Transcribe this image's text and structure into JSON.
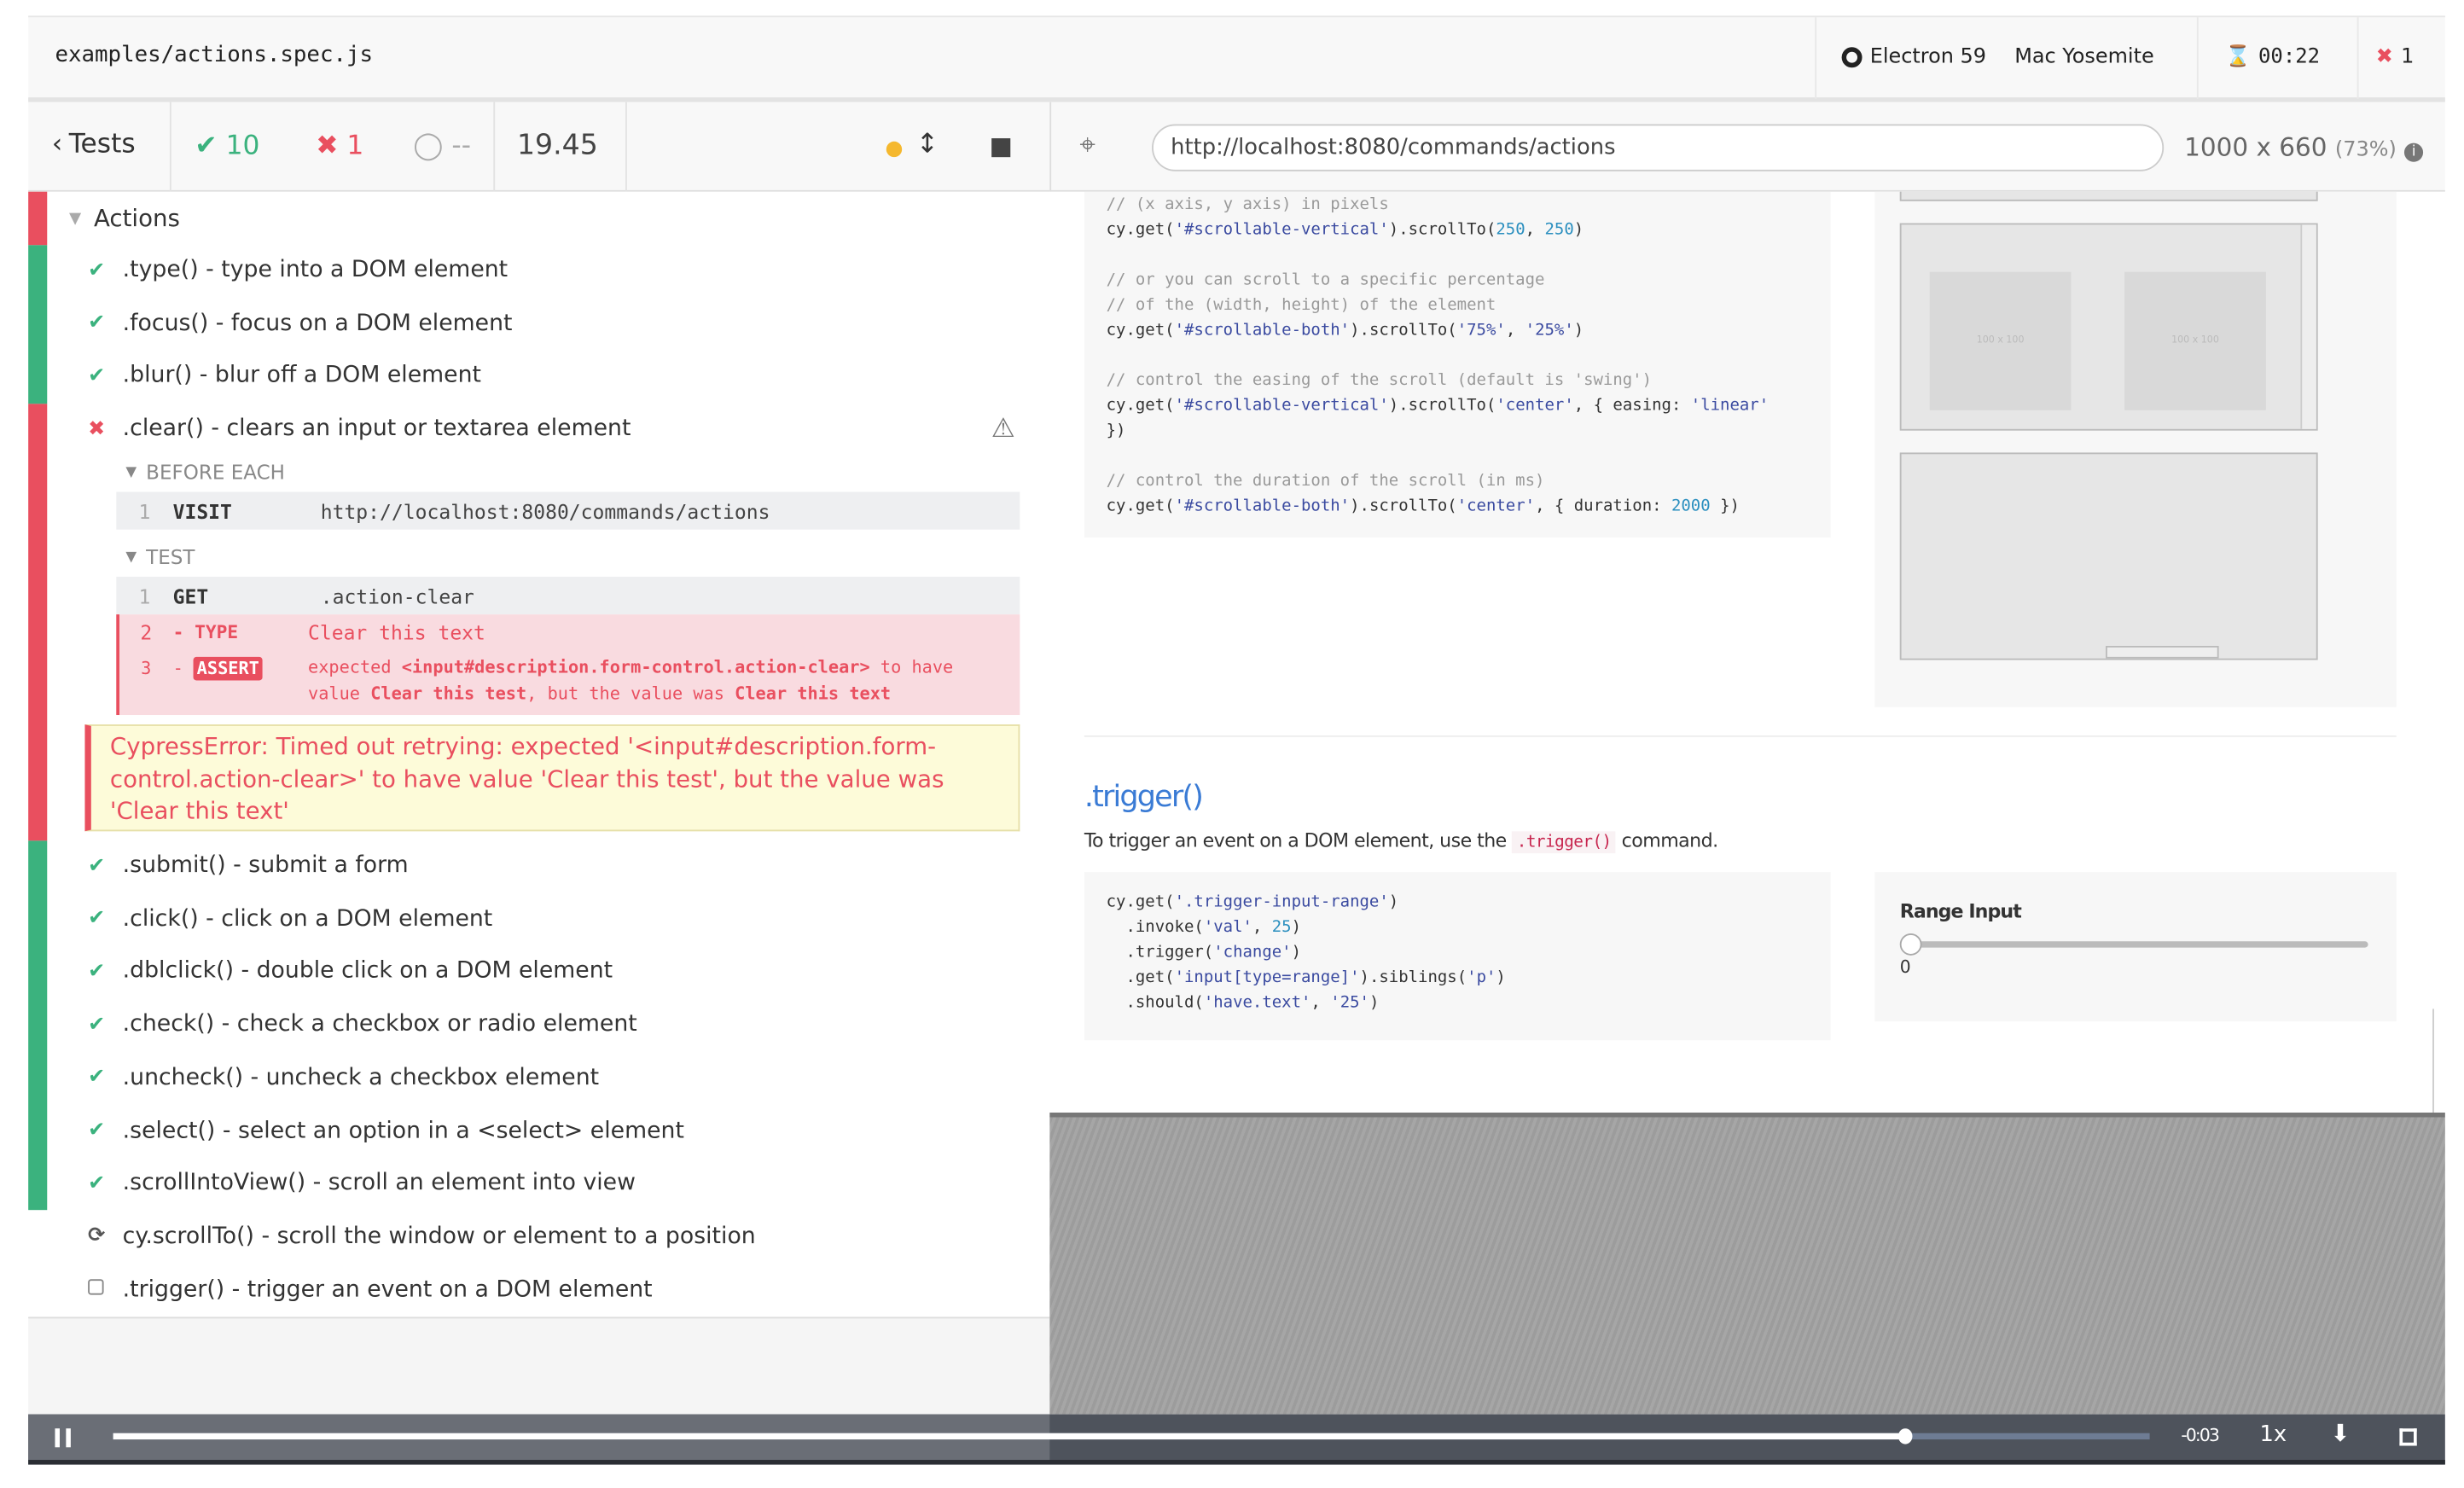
{
  "header": {
    "spec_file": "examples/actions.spec.js",
    "browser": "Electron 59",
    "os": "Mac Yosemite",
    "duration": "00:22",
    "failures": "1"
  },
  "reporter": {
    "tests_button": "Tests",
    "passed": "10",
    "failed": "1",
    "pending": "--",
    "elapsed": "19.45"
  },
  "aut": {
    "url": "http://localhost:8080/commands/actions",
    "viewport": "1000 x 660",
    "scale": "(73%)"
  },
  "suite": {
    "title": "Actions",
    "tests_before": [
      {
        "state": "passed",
        "title": ".type() - type into a DOM element"
      },
      {
        "state": "passed",
        "title": ".focus() - focus on a DOM element"
      },
      {
        "state": "passed",
        "title": ".blur() - blur off a DOM element"
      }
    ],
    "failed_test": {
      "title": ".clear() - clears an input or textarea element",
      "before_each_label": "BEFORE EACH",
      "before_each": [
        {
          "num": "1",
          "name": "VISIT",
          "msg": "http://localhost:8080/commands/actions"
        }
      ],
      "test_label": "TEST",
      "commands": [
        {
          "num": "1",
          "name": "GET",
          "msg": ".action-clear"
        },
        {
          "num": "2",
          "name": "- TYPE",
          "msg": "Clear this text"
        }
      ],
      "assert": {
        "num": "3",
        "dash": "-",
        "name": "ASSERT",
        "p1": "expected",
        "el": "<input#description.form-control.action-clear>",
        "p2": "to have",
        "p3": "value",
        "v1": "Clear this test",
        "p4": ", but the value was",
        "v2": "Clear this text"
      },
      "error": "CypressError: Timed out retrying: expected '<input#description.form-control.action-clear>' to have value 'Clear this test', but the value was 'Clear this text'"
    },
    "tests_after": [
      {
        "state": "passed",
        "title": ".submit() - submit a form"
      },
      {
        "state": "passed",
        "title": ".click() - click on a DOM element"
      },
      {
        "state": "passed",
        "title": ".dblclick() - double click on a DOM element"
      },
      {
        "state": "passed",
        "title": ".check() - check a checkbox or radio element"
      },
      {
        "state": "passed",
        "title": ".uncheck() - uncheck a checkbox element"
      },
      {
        "state": "passed",
        "title": ".select() - select an option in a <select> element"
      },
      {
        "state": "passed",
        "title": ".scrollIntoView() - scroll an element into view"
      },
      {
        "state": "running",
        "title": "cy.scrollTo() - scroll the window or element to a position"
      },
      {
        "state": "pending",
        "title": ".trigger() - trigger an event on a DOM element"
      }
    ]
  },
  "page": {
    "code1": [
      [
        "cm",
        "// (x axis, y axis) in pixels"
      ],
      [
        "mix",
        "cy.get(|'#scrollable-vertical'|).scrollTo(|250|, |250|)"
      ],
      [
        "",
        ""
      ],
      [
        "cm",
        "// or you can scroll to a specific percentage"
      ],
      [
        "cm",
        "// of the (width, height) of the element"
      ],
      [
        "mix",
        "cy.get(|'#scrollable-both'|).scrollTo(|'75%'|, |'25%'|)"
      ],
      [
        "",
        ""
      ],
      [
        "cm",
        "// control the easing of the scroll (default is 'swing')"
      ],
      [
        "mix",
        "cy.get(|'#scrollable-vertical'|).scrollTo(|'center'|, { easing: |'linear'|"
      ],
      [
        "",
        "})"
      ],
      [
        "",
        ""
      ],
      [
        "cm",
        "// control the duration of the scroll (in ms)"
      ],
      [
        "mix",
        "cy.get(|'#scrollable-both'|).scrollTo(|'center'|, { duration: |2000| })"
      ]
    ],
    "box_label": "100 x 100",
    "trigger_heading": ".trigger()",
    "trigger_desc_pre": "To trigger an event on a DOM element, use the",
    "trigger_desc_code": ".trigger()",
    "trigger_desc_post": "command.",
    "code2": [
      [
        "mix",
        "cy.get(|'.trigger-input-range'|)"
      ],
      [
        "mix",
        "  .invoke(|'val'|, |25|)"
      ],
      [
        "mix",
        "  .trigger(|'change'|)"
      ],
      [
        "mix",
        "  .get(|'input[type=range]'|).siblings(|'p'|)"
      ],
      [
        "mix",
        "  .should(|'have.text'|, |'25'|)"
      ]
    ],
    "range_label": "Range Input",
    "range_value": "0"
  },
  "video": {
    "remaining": "-0:03",
    "speed": "1x",
    "progress": 0.88
  },
  "colors": {
    "passed": "#3bb27e",
    "failed": "#e94f5f",
    "running": "#f5b82e",
    "link": "#3a7bd5"
  }
}
